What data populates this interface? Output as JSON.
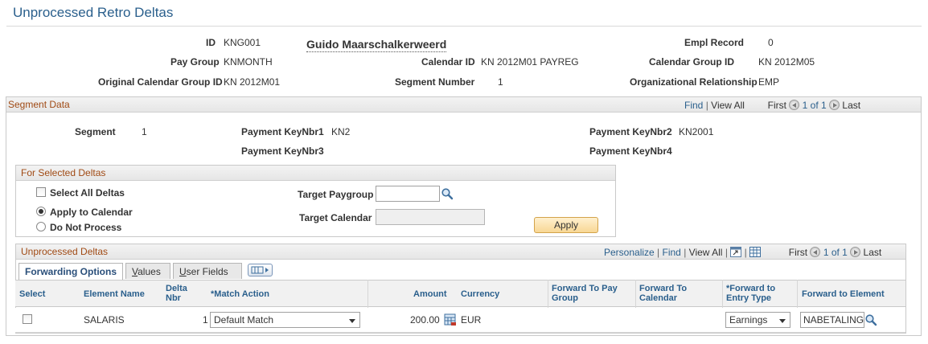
{
  "page": {
    "title": "Unprocessed Retro Deltas"
  },
  "header": {
    "id_label": "ID",
    "id_value": "KNG001",
    "name": "Guido Maarschalkerweerd",
    "empl_record_label": "Empl Record",
    "empl_record_value": "0",
    "pay_group_label": "Pay Group",
    "pay_group_value": "KNMONTH",
    "calendar_id_label": "Calendar ID",
    "calendar_id_value": "KN 2012M01 PAYREG",
    "calendar_group_id_label": "Calendar Group ID",
    "calendar_group_id_value": "KN 2012M05",
    "orig_cal_group_label": "Original Calendar Group ID",
    "orig_cal_group_value": "KN 2012M01",
    "segment_number_label": "Segment Number",
    "segment_number_value": "1",
    "org_rel_label": "Organizational Relationship",
    "org_rel_value": "EMP"
  },
  "segment_data": {
    "title": "Segment Data",
    "nav": {
      "find": "Find",
      "sep": "|",
      "view_all": "View All",
      "first": "First",
      "count": "1 of 1",
      "last": "Last"
    },
    "segment_label": "Segment",
    "segment_value": "1",
    "keynbr1_label": "Payment KeyNbr1",
    "keynbr1_value": "KN2",
    "keynbr2_label": "Payment KeyNbr2",
    "keynbr2_value": "KN2001",
    "keynbr3_label": "Payment KeyNbr3",
    "keynbr4_label": "Payment KeyNbr4"
  },
  "selected_deltas": {
    "title": "For Selected Deltas",
    "select_all_label": "Select All Deltas",
    "apply_to_calendar_label": "Apply to Calendar",
    "do_not_process_label": "Do Not Process",
    "target_paygroup_label": "Target Paygroup",
    "target_paygroup_value": "",
    "target_calendar_label": "Target Calendar",
    "target_calendar_value": "",
    "apply_button": "Apply"
  },
  "unprocessed_deltas": {
    "title": "Unprocessed Deltas",
    "nav": {
      "personalize": "Personalize",
      "sep": "|",
      "find": "Find",
      "view_all": "View All",
      "first": "First",
      "count": "1 of 1",
      "last": "Last"
    },
    "tabs": [
      {
        "label": "Forwarding Options",
        "active": true
      },
      {
        "label": "Values",
        "active": false
      },
      {
        "label": "User Fields",
        "active": false
      }
    ],
    "columns": {
      "select": "Select",
      "element_name": "Element Name",
      "delta_nbr": "Delta Nbr",
      "match_action": "*Match Action",
      "amount": "Amount",
      "currency": "Currency",
      "fwd_pay_group": "Forward To Pay Group",
      "fwd_calendar": "Forward To Calendar",
      "fwd_entry_type": "*Forward to Entry Type",
      "fwd_element": "Forward to Element"
    },
    "rows": [
      {
        "selected": false,
        "element_name": "SALARIS",
        "delta_nbr": "1",
        "match_action": "Default Match",
        "amount": "200.00",
        "currency": "EUR",
        "fwd_pay_group": "",
        "fwd_calendar": "",
        "fwd_entry_type": "Earnings",
        "fwd_element": "NABETALING"
      }
    ]
  },
  "colors": {
    "title_blue": "#2a5f8c",
    "section_orange": "#a04a14",
    "apply_button": "#f8d794"
  },
  "icons": [
    "lookup-icon",
    "calculator-icon",
    "zoom-icon",
    "download-icon",
    "first-arrow-icon",
    "last-arrow-icon",
    "show-all-columns-icon"
  ]
}
